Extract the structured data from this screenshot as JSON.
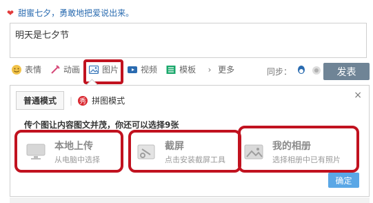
{
  "prompt": {
    "text": "甜蜜七夕，勇敢地把爱说出来。",
    "icon": "heart-icon"
  },
  "composer": {
    "text": "明天是七夕节"
  },
  "toolbar": {
    "items": [
      {
        "label": "表情",
        "icon": "emoji-icon"
      },
      {
        "label": "动画",
        "icon": "animation-icon"
      },
      {
        "label": "图片",
        "icon": "image-icon"
      },
      {
        "label": "视频",
        "icon": "video-icon"
      },
      {
        "label": "模板",
        "icon": "template-icon"
      },
      {
        "label": "更多",
        "icon": "more-icon"
      }
    ],
    "sync_label": "同步：",
    "publish_label": "发表"
  },
  "panel": {
    "tab_normal": "普通模式",
    "tab_collage": "拼图模式",
    "collage_badge": "秀",
    "close_symbol": "×",
    "info_text": "传个图让内容图文并茂，你还可以选择9张",
    "options": [
      {
        "title": "本地上传",
        "subtitle": "从电脑中选择",
        "icon": "monitor-icon"
      },
      {
        "title": "截屏",
        "subtitle": "点击安装截屏工具",
        "icon": "screenshot-icon"
      },
      {
        "title": "我的相册",
        "subtitle": "选择相册中已有照片",
        "icon": "album-icon"
      }
    ],
    "confirm_label": "确定"
  },
  "colors": {
    "link_blue": "#2a6bb0",
    "publish_button": "#6f8496",
    "confirm_button": "#5aa7e6",
    "highlight_red": "#c1121f"
  }
}
